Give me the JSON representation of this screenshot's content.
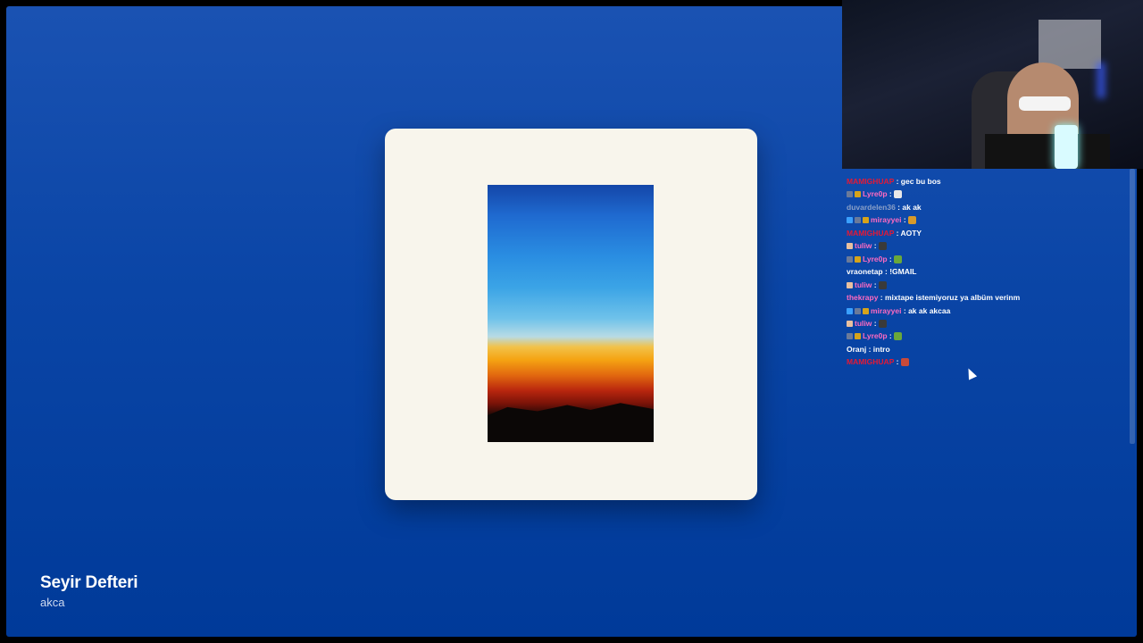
{
  "track": {
    "title": "Seyir Defteri",
    "artist": "akca"
  },
  "chat": {
    "messages": [
      {
        "user": "MAMIGHUAP",
        "color": "#e51935",
        "badges": [],
        "text": "gec bu bos",
        "emote": ""
      },
      {
        "user": "Lyre0p",
        "color": "#ff6ac1",
        "badges": [
          "#6b7a99",
          "#d6a31a"
        ],
        "text": "",
        "emote": "finger-emote"
      },
      {
        "user": "duvardelen36",
        "color": "#8aa0c8",
        "badges": [],
        "text": "ak ak",
        "emote": ""
      },
      {
        "user": "mirayyei",
        "color": "#ff6ac1",
        "badges": [
          "#3aa0ff",
          "#6b7a99",
          "#d6a31a"
        ],
        "text": "",
        "emote": "dance-emote"
      },
      {
        "user": "MAMIGHUAP",
        "color": "#e51935",
        "badges": [],
        "text": "AOTY",
        "emote": ""
      },
      {
        "user": "tuliw",
        "color": "#ff6ac1",
        "badges": [
          "#e8c0a0"
        ],
        "text": "",
        "emote": "face-emote"
      },
      {
        "user": "Lyre0p",
        "color": "#ff6ac1",
        "badges": [
          "#6b7a99",
          "#d6a31a"
        ],
        "text": "",
        "emote": "frog-emote"
      },
      {
        "user": "vraonetap",
        "color": "#ffffff",
        "badges": [],
        "text": "!GMAIL",
        "emote": ""
      },
      {
        "user": "tuliw",
        "color": "#ff6ac1",
        "badges": [
          "#e8c0a0"
        ],
        "text": "",
        "emote": "face-emote"
      },
      {
        "user": "thekrapy",
        "color": "#ff6ac1",
        "badges": [],
        "text": "mixtape istemiyoruz ya albüm verinm",
        "emote": ""
      },
      {
        "user": "mirayyei",
        "color": "#ff6ac1",
        "badges": [
          "#3aa0ff",
          "#6b7a99",
          "#d6a31a"
        ],
        "text": "ak ak akcaa",
        "emote": ""
      },
      {
        "user": "tuliw",
        "color": "#ff6ac1",
        "badges": [
          "#e8c0a0"
        ],
        "text": "",
        "emote": "face-emote"
      },
      {
        "user": "Lyre0p",
        "color": "#ff6ac1",
        "badges": [
          "#6b7a99",
          "#d6a31a"
        ],
        "text": "",
        "emote": "frog-emote"
      },
      {
        "user": "Oranj",
        "color": "#ffffff",
        "badges": [],
        "text": "intro",
        "emote": ""
      },
      {
        "user": "MAMIGHUAP",
        "color": "#e51935",
        "badges": [],
        "text": "",
        "emote": "cat-emote"
      }
    ]
  },
  "emote_colors": {
    "finger-emote": "#e8e8e8",
    "dance-emote": "#d89a2a",
    "face-emote": "#3a3a3a",
    "frog-emote": "#6aa83a",
    "cat-emote": "#c84a3a"
  }
}
